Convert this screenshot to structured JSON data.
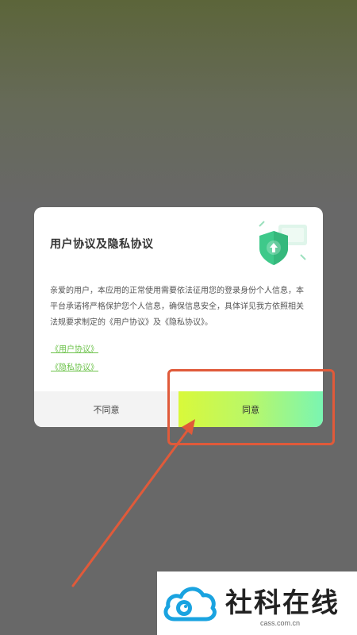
{
  "dialog": {
    "title": "用户协议及隐私协议",
    "body": "亲爱的用户，本应用的正常使用需要依法征用您的登录身份个人信息，本平台承诺将严格保护您个人信息，确保信息安全，具体详见我方依照相关法规要求制定的《用户协议》及《隐私协议》。",
    "links": [
      "《用户协议》",
      "《隐私协议》"
    ],
    "buttons": {
      "disagree": "不同意",
      "agree": "同意"
    },
    "icon": "shield-upload-icon"
  },
  "annotation": {
    "color": "#e05a3a",
    "target": "agree-button"
  },
  "watermark": {
    "title": "社科在线",
    "url": "cass.com.cn"
  },
  "colors": {
    "link": "#6cc24a",
    "agree_start": "#d9f93a",
    "agree_end": "#7af5b2",
    "shield": "#3ec98a"
  }
}
